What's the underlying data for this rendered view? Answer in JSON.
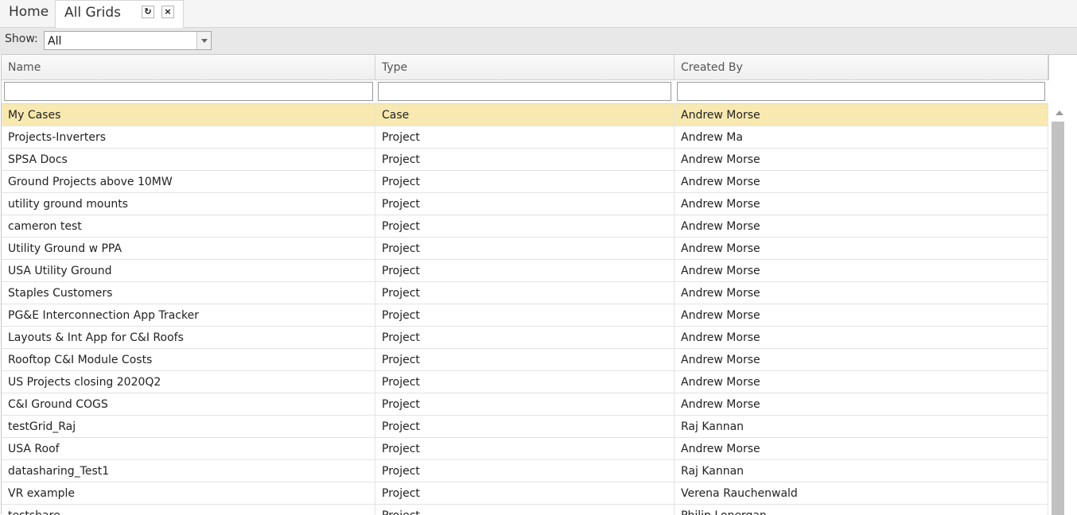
{
  "tabs": {
    "home_label": "Home",
    "active_label": "All Grids",
    "refresh_icon": "↻",
    "close_icon": "×"
  },
  "filter": {
    "show_label": "Show:",
    "show_value": "All"
  },
  "grid": {
    "columns": [
      "Name",
      "Type",
      "Created By"
    ],
    "rows": [
      {
        "name": "My Cases",
        "type": "Case",
        "created_by": "Andrew Morse",
        "selected": true
      },
      {
        "name": "Projects-Inverters",
        "type": "Project",
        "created_by": "Andrew Ma"
      },
      {
        "name": "SPSA Docs",
        "type": "Project",
        "created_by": "Andrew Morse"
      },
      {
        "name": "Ground Projects above 10MW",
        "type": "Project",
        "created_by": "Andrew Morse"
      },
      {
        "name": "utility ground mounts",
        "type": "Project",
        "created_by": "Andrew Morse"
      },
      {
        "name": "cameron test",
        "type": "Project",
        "created_by": "Andrew Morse"
      },
      {
        "name": "Utility Ground w PPA",
        "type": "Project",
        "created_by": "Andrew Morse"
      },
      {
        "name": "USA Utility Ground",
        "type": "Project",
        "created_by": "Andrew Morse"
      },
      {
        "name": "Staples Customers",
        "type": "Project",
        "created_by": "Andrew Morse"
      },
      {
        "name": "PG&E Interconnection App Tracker",
        "type": "Project",
        "created_by": "Andrew Morse"
      },
      {
        "name": "Layouts & Int App for C&I Roofs",
        "type": "Project",
        "created_by": "Andrew Morse"
      },
      {
        "name": "Rooftop C&I Module Costs",
        "type": "Project",
        "created_by": "Andrew Morse"
      },
      {
        "name": "US Projects closing 2020Q2",
        "type": "Project",
        "created_by": "Andrew Morse"
      },
      {
        "name": "C&I Ground COGS",
        "type": "Project",
        "created_by": "Andrew Morse"
      },
      {
        "name": "testGrid_Raj",
        "type": "Project",
        "created_by": "Raj Kannan"
      },
      {
        "name": "USA Roof",
        "type": "Project",
        "created_by": "Andrew Morse"
      },
      {
        "name": "datasharing_Test1",
        "type": "Project",
        "created_by": "Raj Kannan"
      },
      {
        "name": "VR example",
        "type": "Project",
        "created_by": "Verena Rauchenwald"
      },
      {
        "name": "testshare",
        "type": "Project",
        "created_by": "Philip Lonergan"
      }
    ]
  },
  "colors": {
    "selected_row": "#f8e9b0",
    "header_bg": "#f2f2f2",
    "filter_bar_bg": "#e8e8e8"
  }
}
